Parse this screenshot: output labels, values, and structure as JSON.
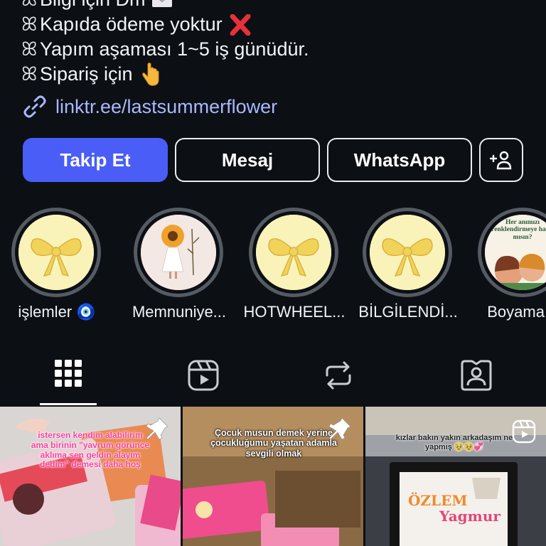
{
  "bio": {
    "lines": [
      {
        "text": "Bilgi için Dm",
        "emoji": "envelope-icon"
      },
      {
        "text": "Kapıda ödeme yoktur",
        "emoji": "cross-mark-icon"
      },
      {
        "text": "Yapım aşaması 1~5 iş günüdür.",
        "emoji": ""
      },
      {
        "text": "Sipariş için",
        "emoji": "point-down-icon"
      }
    ],
    "link": "linktr.ee/lastsummerflower"
  },
  "buttons": {
    "follow": "Takip Et",
    "message": "Mesaj",
    "whatsapp": "WhatsApp"
  },
  "highlights": [
    {
      "label": "işlemler 🧿",
      "image": "yellow-bow"
    },
    {
      "label": "Memnuniye...",
      "image": "sunflower-girl"
    },
    {
      "label": "HOTWHEEL...",
      "image": "yellow-bow"
    },
    {
      "label": "BİLGİLENDİ...",
      "image": "yellow-bow"
    },
    {
      "label": "Boyama K",
      "image": "couple-illustration",
      "caption": "Her anımızı renklendirmeye hazır mısın?"
    }
  ],
  "tabs": [
    {
      "name": "grid-icon",
      "active": true
    },
    {
      "name": "reels-icon",
      "active": false
    },
    {
      "name": "reposts-icon",
      "active": false
    },
    {
      "name": "tagged-icon",
      "active": false
    }
  ],
  "posts": [
    {
      "overlay": "istersen kendim alabilirim ama birinin \"yavrum görünce aklıma sen geldin alayım dedim\" demesi daha hoş",
      "pinned": true
    },
    {
      "overlay": "Çocuk musun demek yerine çocukluğumu yaşatan adamla sevgili olmak",
      "pinned": true
    },
    {
      "overlay": "kızlar bakın yakın arkadaşım ne yapmış 🥹🥹💞",
      "pinned": false,
      "frame_name_1": "ÖZLEM",
      "frame_name_2": "Yagmur"
    }
  ],
  "colors": {
    "background": "#0c0f14",
    "accent": "#4a5df7",
    "link": "#a9b8ff"
  }
}
